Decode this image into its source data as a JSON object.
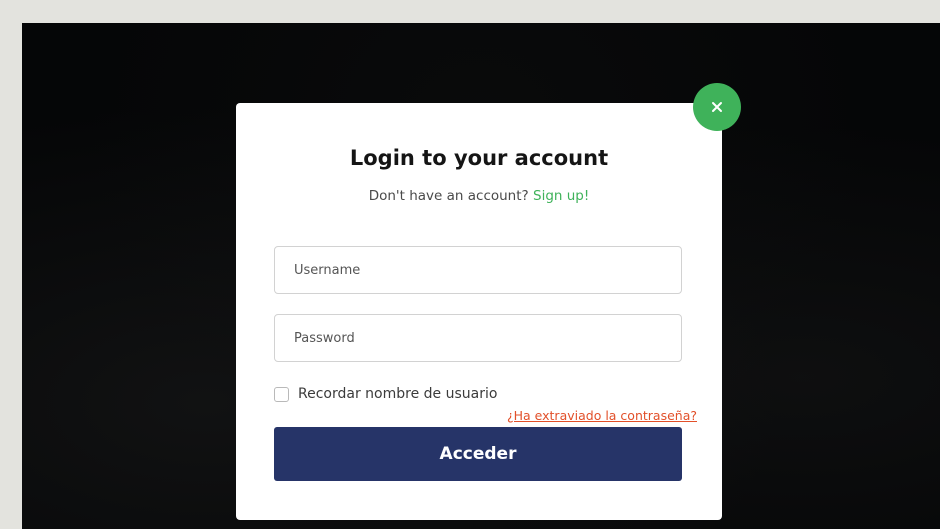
{
  "modal": {
    "title": "Login to your account",
    "signup_prompt": "Don't have an account?",
    "signup_link": "Sign up!",
    "close_icon": "close-icon",
    "username_placeholder": "Username",
    "username_value": "",
    "password_placeholder": "Password",
    "password_value": "",
    "remember_label": "Recordar nombre de usuario",
    "remember_checked": false,
    "forgot_link": "¿Ha extraviado la contraseña?",
    "submit_label": "Acceder"
  },
  "colors": {
    "accent_green": "#3fb25a",
    "button_navy": "#263468",
    "link_orange": "#e2502a",
    "backdrop": "#050607",
    "page_bg": "#e3e3de"
  }
}
